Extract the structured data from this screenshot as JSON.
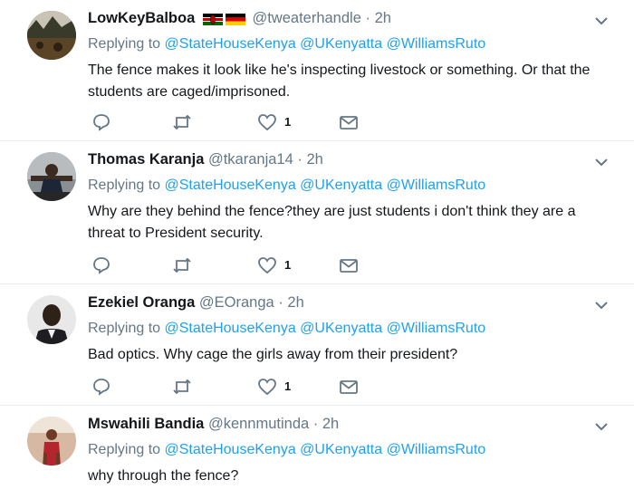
{
  "replying_prefix": "Replying to",
  "mentions": [
    "@StateHouseKenya",
    "@UKenyatta",
    "@WilliamsRuto"
  ],
  "tweets": [
    {
      "name": "LowKeyBalboa",
      "handle": "@tweaterhandle",
      "time": "2h",
      "text": "The fence makes it look like he's inspecting livestock or something. Or that the students are caged/imprisoned.",
      "likes": "1"
    },
    {
      "name": "Thomas Karanja",
      "handle": "@tkaranja14",
      "time": "2h",
      "text": "Why are they behind the fence?they are just students i don't think they are a threat to President security.",
      "likes": "1"
    },
    {
      "name": "Ezekiel Oranga",
      "handle": "@EOranga",
      "time": "2h",
      "text": "Bad optics. Why cage the girls away from their president?",
      "likes": "1"
    },
    {
      "name": "Mswahili Bandia",
      "handle": "@kennmutinda",
      "time": "2h",
      "text": "why through the fence?",
      "likes": ""
    }
  ],
  "colors": {
    "link": "#1da1f2",
    "secondary": "#657786",
    "divider": "#e6ecf0",
    "icon": "#657786"
  },
  "icons": [
    "reply-icon",
    "retweet-icon",
    "like-icon",
    "direct-message-icon",
    "chevron-down-icon",
    "kenya-flag-icon",
    "germany-flag-icon"
  ]
}
